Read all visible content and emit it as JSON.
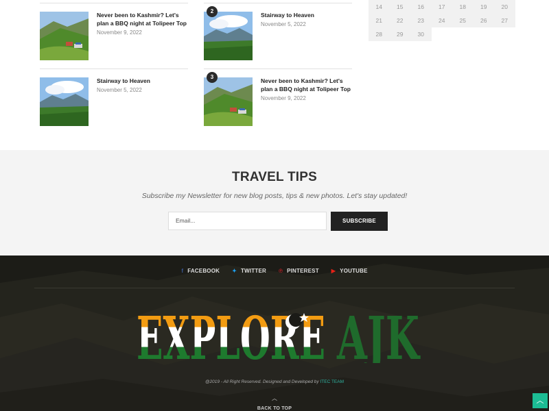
{
  "posts_left": [
    {
      "title": "Never been to Kashmir? Let's plan a BBQ night at Tolipeer Top",
      "date": "November 9, 2022",
      "image": "hillside-village"
    },
    {
      "title": "Stairway to Heaven",
      "date": "November 5, 2022",
      "image": "mountain-valley"
    }
  ],
  "posts_right": [
    {
      "rank": "2",
      "title": "Stairway to Heaven",
      "date": "November 5, 2022",
      "image": "mountain-valley"
    },
    {
      "rank": "3",
      "title": "Never been to Kashmir? Let's plan a BBQ night at Tolipeer Top",
      "date": "November 9, 2022",
      "image": "hillside-village"
    }
  ],
  "calendar": {
    "rows": [
      [
        "14",
        "15",
        "16",
        "17",
        "18",
        "19",
        "20"
      ],
      [
        "21",
        "22",
        "23",
        "24",
        "25",
        "26",
        "27"
      ],
      [
        "28",
        "29",
        "30",
        "",
        "",
        "",
        ""
      ]
    ]
  },
  "newsletter": {
    "title": "TRAVEL TIPS",
    "subtitle": "Subscribe my Newsletter for new blog posts, tips & new photos. Let's stay updated!",
    "email_placeholder": "Email...",
    "button_label": "SUBSCRIBE"
  },
  "social": [
    {
      "label": "FACEBOOK",
      "icon": "facebook-icon",
      "glyph": "f",
      "color": "#3b5998"
    },
    {
      "label": "TWITTER",
      "icon": "twitter-icon",
      "glyph": "✦",
      "color": "#1da1f2"
    },
    {
      "label": "PINTEREST",
      "icon": "pinterest-icon",
      "glyph": "℗",
      "color": "#cb2027"
    },
    {
      "label": "YOUTUBE",
      "icon": "youtube-icon",
      "glyph": "▶",
      "color": "#e62117"
    }
  ],
  "footer": {
    "logo_text_1": "EXPLORE",
    "logo_text_2": "AJK",
    "copyright": "@2019 - All Right Reserved. Designed and Developed by ",
    "copyright_team": "ITEC TEAM",
    "back_to_top": "BACK TO TOP",
    "back_to_top_icon": "chevron-up-icon",
    "scroll_top_icon": "chevron-up-icon"
  },
  "colors": {
    "accent": "#1cbc94",
    "logo_orange": "#f39c12",
    "logo_green": "#1e7a2e",
    "team_link": "#2fb5a3"
  }
}
